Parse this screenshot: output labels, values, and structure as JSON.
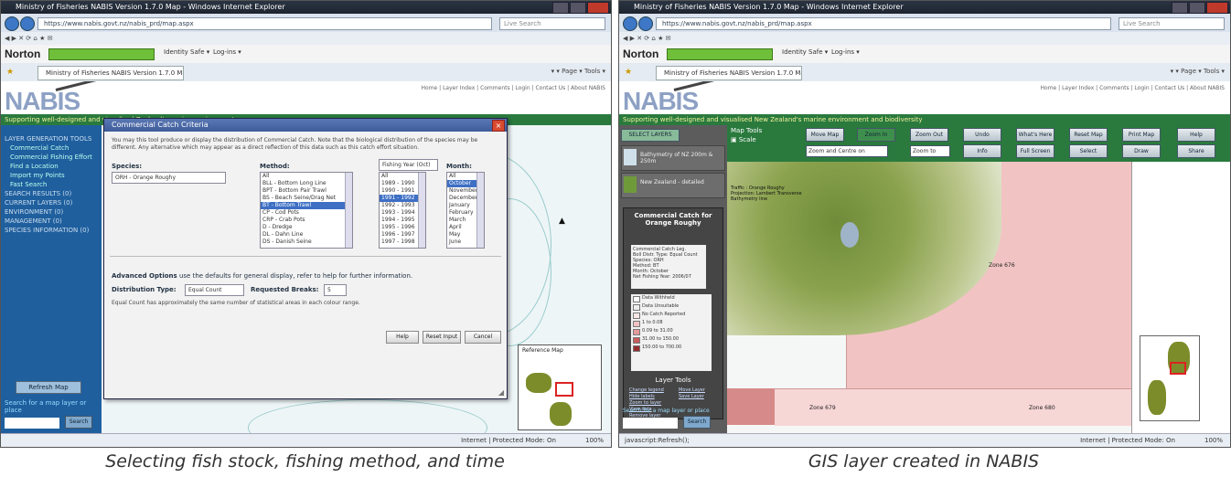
{
  "captions": {
    "left": "Selecting fish stock, fishing method, and time",
    "right": "GIS layer created in NABIS"
  },
  "left": {
    "window_title": "Ministry of Fisheries NABIS Version 1.7.0 Map - Windows Internet Explorer",
    "address": "https://www.nabis.govt.nz/nabis_prd/map.aspx",
    "search_placeholder": "Live Search",
    "norton": "Norton",
    "norton_items": [
      "Identity Safe ▾",
      "Log-ins ▾"
    ],
    "tab": "Ministry of Fisheries NABIS Version 1.7.0 Map",
    "tools": "▾  ▾  Page ▾  Tools ▾",
    "logo": "NABIS",
    "top_links": "Home | Layer Index | Comments | Login | Contact Us | About NABIS",
    "tagline": "Supporting well-designed and visualised Zealand's marine environment",
    "sidebar": [
      {
        "label": "LAYER GENERATION TOOLS",
        "sub": false
      },
      {
        "label": "Commercial Catch",
        "sub": true
      },
      {
        "label": "Commercial Fishing Effort",
        "sub": true
      },
      {
        "label": "Find a Location",
        "sub": true
      },
      {
        "label": "Import my Points",
        "sub": true
      },
      {
        "label": "Fast Search",
        "sub": true
      },
      {
        "label": "SEARCH RESULTS (0)",
        "sub": false
      },
      {
        "label": "CURRENT LAYERS (0)",
        "sub": false
      },
      {
        "label": "ENVIRONMENT (0)",
        "sub": false
      },
      {
        "label": "MANAGEMENT (0)",
        "sub": false
      },
      {
        "label": "SPECIES INFORMATION (0)",
        "sub": false
      }
    ],
    "refresh_btn": "Refresh Map",
    "search_link": "Search for a map layer or place",
    "search_go": "Search",
    "dialog": {
      "title": "Commercial Catch Criteria",
      "info": "You may this tool produce or display the distribution of Commercial Catch. Note that the biological distribution of the species may be different. Any alternative which may appear as a direct reflection of this data such as this catch effort situation.",
      "species_label": "Species:",
      "species_value": "ORH - Orange Roughy",
      "method_label": "Method:",
      "methods": [
        "All",
        "BLL - Bottom Long Line",
        "BPT - Bottom Pair Trawl",
        "BS - Beach Seine/Drag Net",
        "BT - Bottom Trawl",
        "CP - Cod Pots",
        "CRP - Crab Pots",
        "D - Dredge",
        "DL - Dahn Line",
        "DS - Danish Seine"
      ],
      "selected_method": 4,
      "year_label": "Fishing Year (Oct)",
      "years": [
        "All",
        "1989 - 1990",
        "1990 - 1991",
        "1991 - 1992",
        "1992 - 1993",
        "1993 - 1994",
        "1994 - 1995",
        "1995 - 1996",
        "1996 - 1997",
        "1997 - 1998"
      ],
      "selected_year": 3,
      "month_label": "Month:",
      "months": [
        "All",
        "October",
        "November",
        "December",
        "January",
        "February",
        "March",
        "April",
        "May",
        "June"
      ],
      "selected_month": 1,
      "adv_title": "Advanced Options",
      "adv_text": "use the defaults for general display, refer to help for further information.",
      "dist_label": "Distribution Type:",
      "dist_value": "Equal Count",
      "breaks_label": "Requested Breaks:",
      "breaks_value": "5",
      "adv_note": "Equal Count has approximately the same number of statistical areas in each colour range.",
      "buttons": [
        "Help",
        "Reset Input",
        "Cancel"
      ]
    },
    "map_label": "Reference Map",
    "status_zone": "Internet | Protected Mode: On",
    "status_zoom": "100%"
  },
  "right": {
    "window_title": "Ministry of Fisheries NABIS Version 1.7.0 Map - Windows Internet Explorer",
    "address": "https://www.nabis.govt.nz/nabis_prd/map.aspx",
    "search_placeholder": "Live Search",
    "norton": "Norton",
    "norton_items": [
      "Identity Safe ▾",
      "Log-ins ▾"
    ],
    "tab": "Ministry of Fisheries NABIS Version 1.7.0 Map",
    "tools": "▾  ▾  Page ▾  Tools ▾",
    "logo": "NABIS",
    "top_links": "Home | Layer Index | Comments | Login | Contact Us | About NABIS",
    "tagline": "Supporting well-designed and visualised New Zealand's marine environment and biodiversity",
    "select_layers_btn": "SELECT LAYERS",
    "layers": [
      "Bathymetry of NZ 200m & 250m",
      "New Zealand - detailed"
    ],
    "panel_title": "Commercial Catch for Orange Roughy",
    "details": "Commercial Catch Leg.\nBoll Distr. Type: Equal Count\nSpecies: ORH\nMethod: BT\nMonth: October\nNet Fishing Year: 2006/07",
    "legend": [
      "Data Withheld",
      "Data Unsuitable",
      "No Catch Reported",
      "1 to 0.08",
      "0.09 to 31.00",
      "31.00 to 150.00",
      "150.00 to 700.00"
    ],
    "legend_colors": [
      "#ffffff",
      "#eeeeee",
      "#fbe9e9",
      "#f2c3c3",
      "#e49a9a",
      "#c85c5c",
      "#962d2d"
    ],
    "layer_tools_title": "Layer Tools",
    "layer_tools": [
      "Change legend",
      "Hide labels",
      "Zoom to layer",
      "View data",
      "Remove layer",
      "Move Layer",
      "Save Layer"
    ],
    "map_tools_label": "Map Tools",
    "scale_label": "Scale",
    "toolbar_buttons": [
      "Move Map",
      "Zoom Out",
      "Undo",
      "What's Here",
      "Reset Map",
      "Print Map",
      "Help",
      "Zoom In",
      "Info",
      "Full Screen",
      "Select",
      "Draw",
      "Share"
    ],
    "locate_select": "Zoom and Centre on",
    "zoom_select": "Zoom to",
    "map_text": [
      "Traffic : Orange Roughy",
      "Projection: Lambert Transverse",
      "Bathymetry line"
    ],
    "map_labels": [
      "Zone 676",
      "Zone 679",
      "Zone 680"
    ],
    "status_url": "javascript:Refresh();",
    "status_zone": "Internet | Protected Mode: On",
    "status_zoom": "100%"
  }
}
